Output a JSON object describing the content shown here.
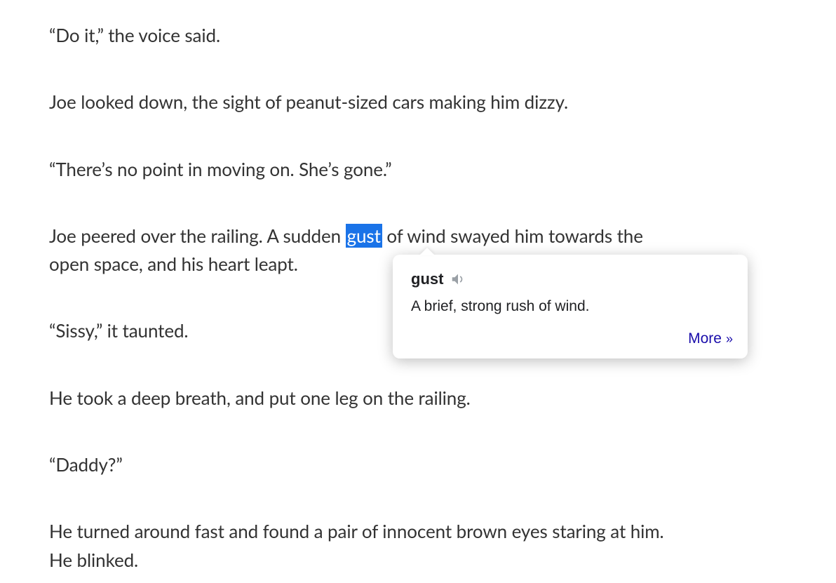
{
  "story": {
    "p1": "“Do it,” the voice said.",
    "p2": "Joe looked down, the sight of peanut-sized cars making him dizzy.",
    "p3": "“There’s no point in moving on. She’s gone.”",
    "p4_pre": "Joe peered over the railing. A sudden ",
    "p4_highlight": "gust",
    "p4_post": " of wind swayed him towards the open space, and his heart leapt.",
    "p5": "“Sissy,” it taunted.",
    "p6": "He took a deep breath, and put one leg on the railing.",
    "p7": "“Daddy?”",
    "p8": "He turned around fast and found a pair of innocent brown eyes staring at him. He blinked."
  },
  "tooltip": {
    "word": "gust",
    "definition": "A brief, strong rush of wind.",
    "more_label": "More"
  }
}
